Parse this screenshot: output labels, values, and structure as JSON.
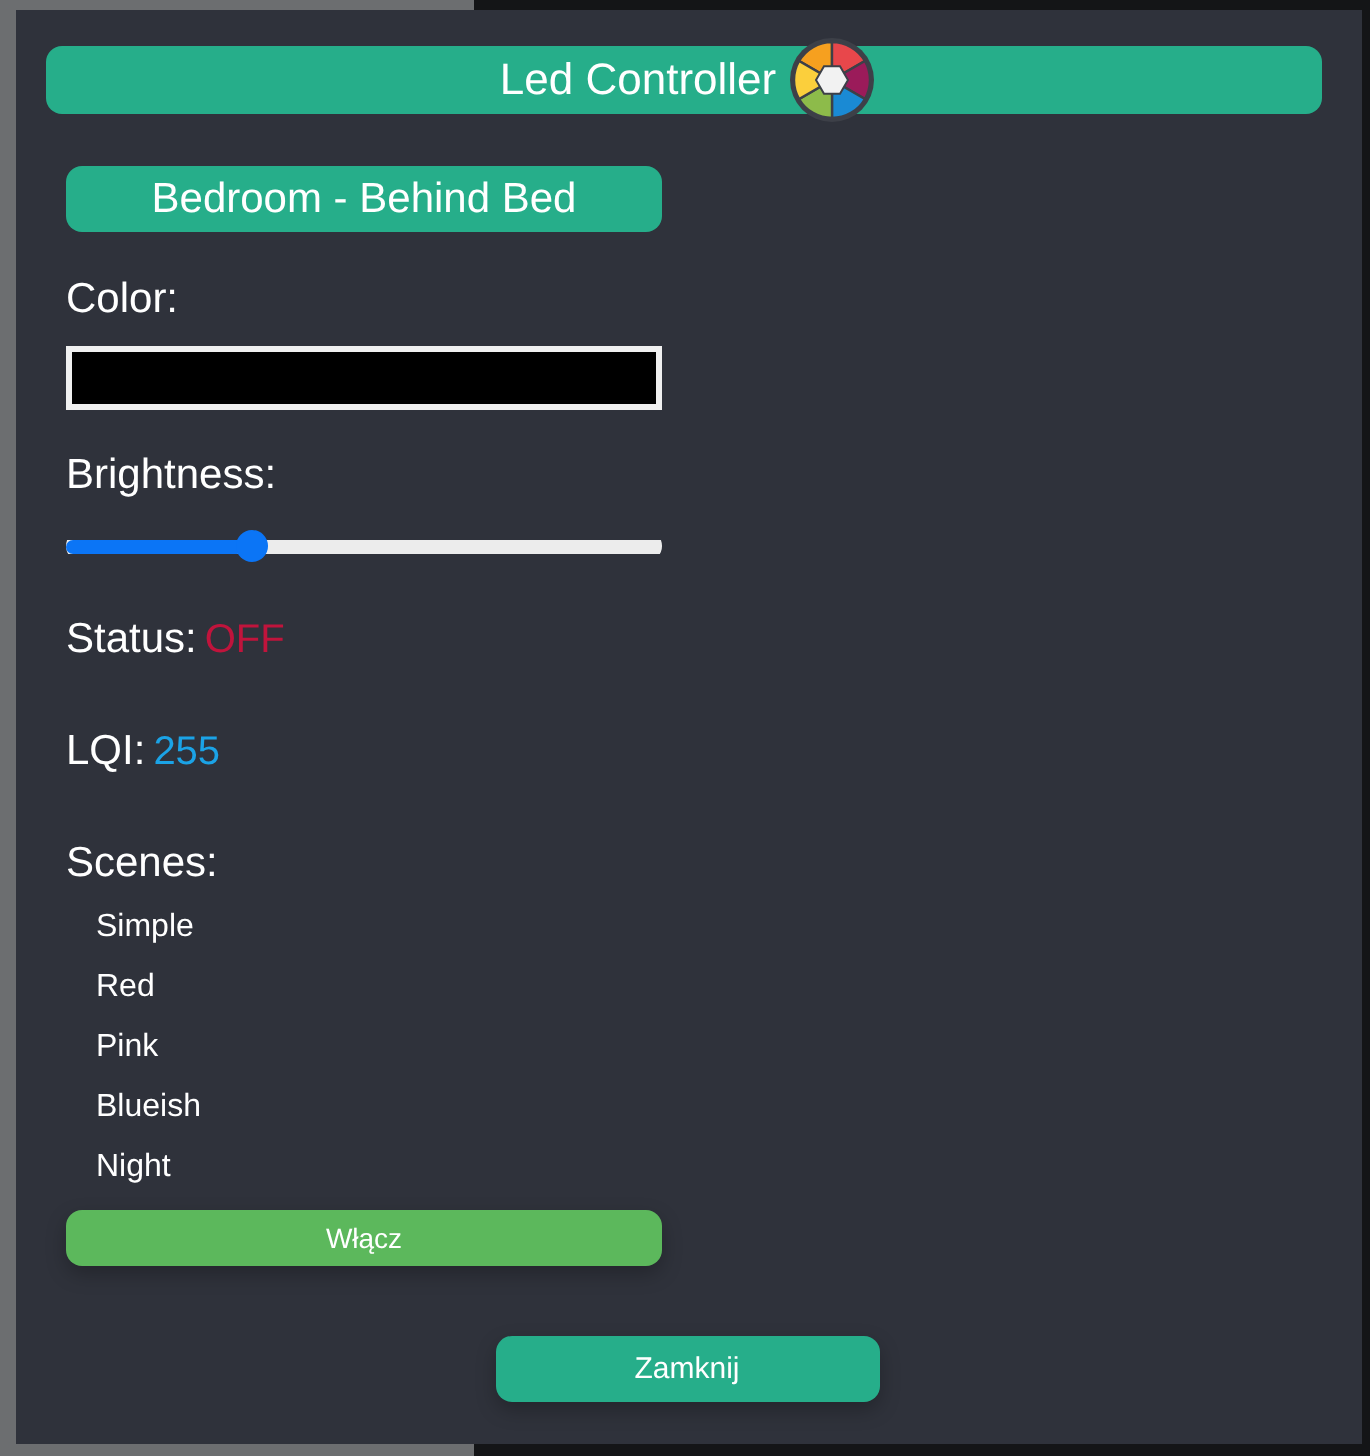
{
  "dialog": {
    "title": "Led Controller"
  },
  "device": {
    "name": "Bedroom - Behind Bed"
  },
  "color": {
    "label": "Color:",
    "color": "#000000"
  },
  "brightness": {
    "label": "Brightness:",
    "level": 0.3
  },
  "status": {
    "label": "Status:",
    "value": "OFF",
    "on": false
  },
  "lqi": {
    "label": "LQI:",
    "value": "255"
  },
  "scenes": {
    "label": "Scenes:",
    "items": [
      {
        "label": "Simple"
      },
      {
        "label": "Red"
      },
      {
        "label": "Pink"
      },
      {
        "label": "Blueish"
      },
      {
        "label": "Night"
      }
    ]
  },
  "buttons": {
    "apply": "Włącz",
    "close": "Zamknij"
  }
}
